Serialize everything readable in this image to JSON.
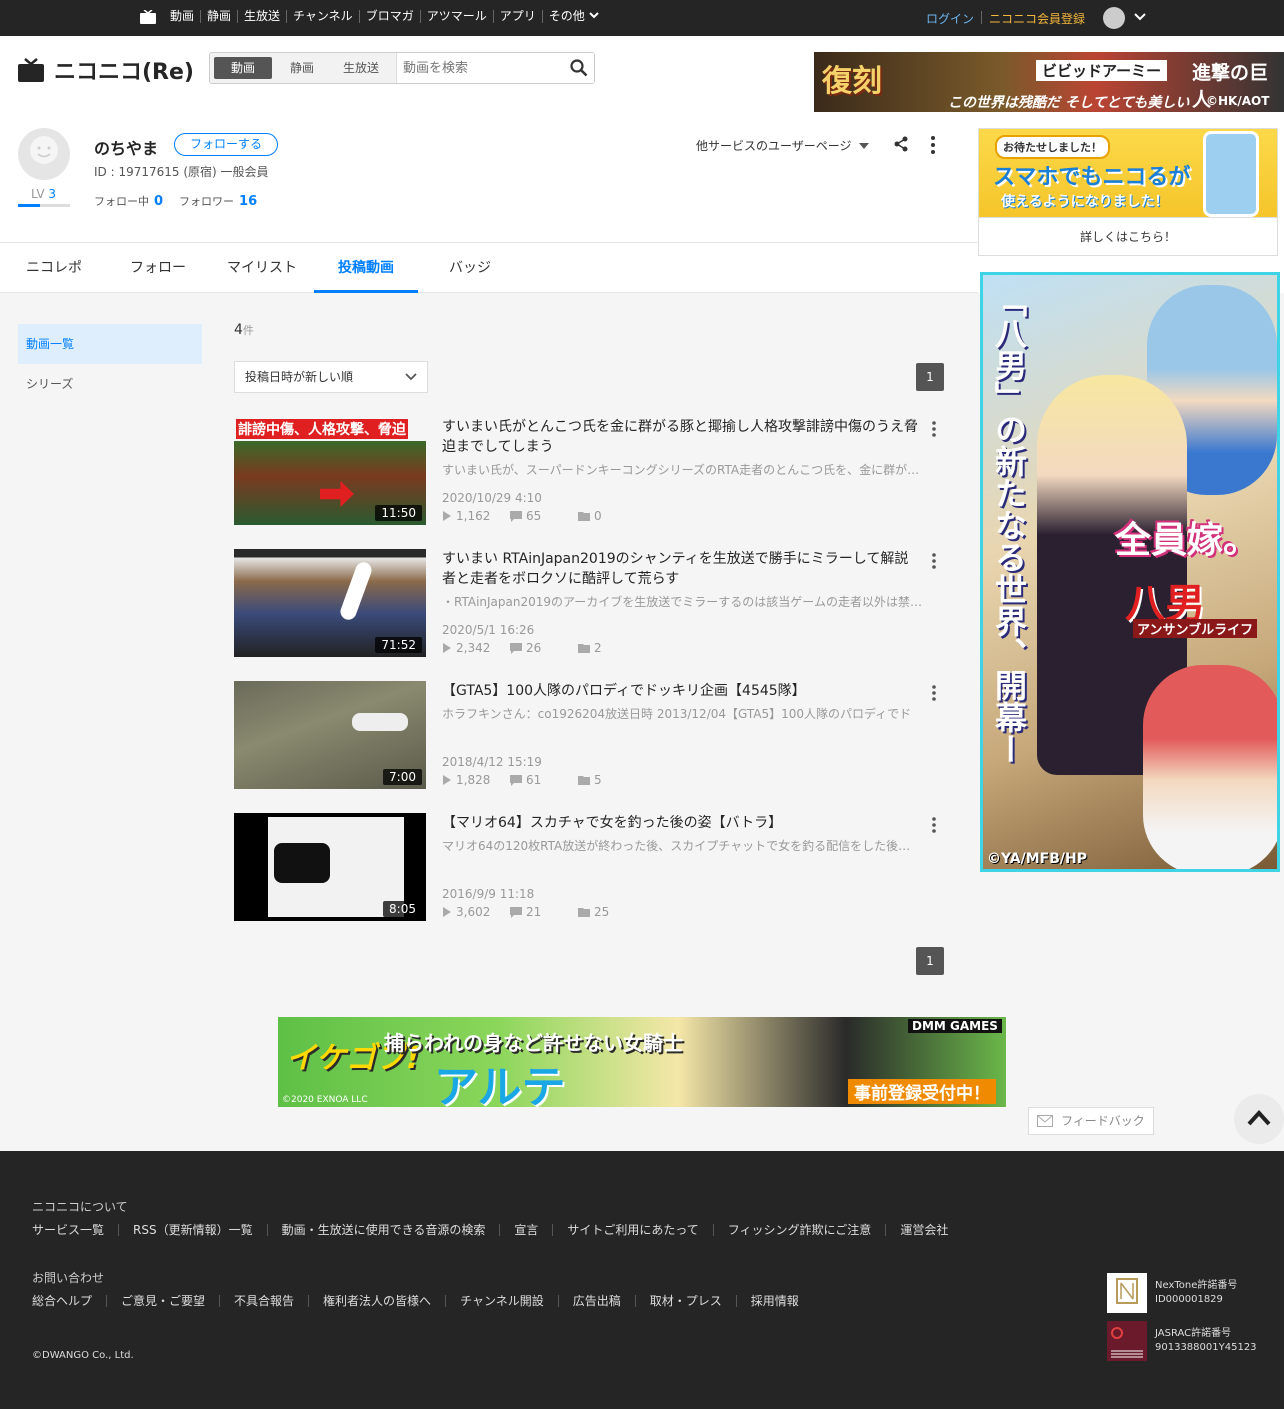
{
  "topnav": {
    "links": [
      "動画",
      "静画",
      "生放送",
      "チャンネル",
      "ブロマガ",
      "アツマール",
      "アプリ",
      "その他"
    ],
    "login": "ログイン",
    "register": "ニコニコ会員登録"
  },
  "header": {
    "logo": "ニコニコ(Re)",
    "search_tabs": [
      "動画",
      "静画",
      "生放送"
    ],
    "search_placeholder": "動画を検索",
    "banner": {
      "t1": "復刻",
      "t2": "ビビッドアーミー",
      "t3": "進撃の巨人",
      "t4": "この世界は残酷だ そしてとても美しい",
      "t5": "©HK/AOT"
    }
  },
  "user": {
    "name": "のちやま",
    "follow_button": "フォローする",
    "id_line": "ID : 19717615 (原宿) 一般会員",
    "level_label": "LV",
    "level": "3",
    "level_progress": 0.42,
    "following_label": "フォロー中",
    "following": "0",
    "followers_label": "フォロワー",
    "followers": "16",
    "other_services": "他サービスのユーザーページ"
  },
  "tabs": [
    "ニコレポ",
    "フォロー",
    "マイリスト",
    "投稿動画",
    "バッジ"
  ],
  "sidebar": [
    "動画一覧",
    "シリーズ"
  ],
  "list": {
    "count": "4",
    "count_unit": "件",
    "sort": "投稿日時が新しい順",
    "page": "1",
    "items": [
      {
        "title": "すいまい氏がとんこつ氏を金に群がる豚と揶揄し人格攻撃誹謗中傷のうえ脅迫までしてしまう",
        "desc": "すいまい氏が、スーパードンキーコングシリーズのRTA走者のとんこつ氏を、金に群がる豚と揶揄し人格攻撃誹謗中傷",
        "date": "2020/10/29 4:10",
        "views": "1,162",
        "comments": "65",
        "mylists": "0",
        "duration": "11:50"
      },
      {
        "title": "すいまい RTAinJapan2019のシャンティを生放送で勝手にミラーして解説者と走者をボロクソに酷評して荒らす",
        "desc": "・RTAinJapan2019のアーカイブを生放送でミラーするのは該当ゲームの走者以外は禁止されています",
        "date": "2020/5/1 16:26",
        "views": "2,342",
        "comments": "26",
        "mylists": "2",
        "duration": "71:52"
      },
      {
        "title": "【GTA5】100人隊のパロディでドッキリ企画【4545隊】",
        "desc": "ホラフキンさん：co1926204放送日時 2013/12/04【GTA5】100人隊のパロディでド",
        "date": "2018/4/12 15:19",
        "views": "1,828",
        "comments": "61",
        "mylists": "5",
        "duration": "7:00"
      },
      {
        "title": "【マリオ64】スカチャで女を釣った後の姿【バトラ】",
        "desc": "マリオ64の120枚RTA放送が終わった後、スカイプチャットで女を釣る配信をした後の姿",
        "date": "2016/9/9 11:18",
        "views": "3,602",
        "comments": "21",
        "mylists": "25",
        "duration": "8:05"
      }
    ]
  },
  "ads": {
    "right_top": {
      "t1": "お待たせしました！",
      "t2": "スマホでもニコるが",
      "t3": "使えるようになりました！",
      "link": "詳しくはこちら！"
    },
    "right_tall": {
      "vert": "「八男」の新たなる世界、開幕ー",
      "t1": "全員嫁。",
      "t2": "八男",
      "t3": "アンサンブルライフ",
      "copy": "©YA/MFB/HP"
    },
    "bottom": {
      "t1": "イケゴブ!",
      "t2": "捕らわれの身など許せない女騎士",
      "t3": "アルテ",
      "t4": "DMM GAMES",
      "t5": "事前登録受付中！",
      "t6": "©2020 EXNOA LLC"
    }
  },
  "feedback": "フィードバック",
  "footer": {
    "about": "ニコニコについて",
    "row1": [
      "サービス一覧",
      "RSS（更新情報）一覧",
      "動画・生放送に使用できる音源の検索",
      "宣言",
      "サイトご利用にあたって",
      "フィッシング詐欺にご注意",
      "運営会社"
    ],
    "contact": "お問い合わせ",
    "row2": [
      "総合ヘルプ",
      "ご意見・ご要望",
      "不具合報告",
      "権利者法人の皆様へ",
      "チャンネル開設",
      "広告出稿",
      "取材・プレス",
      "採用情報"
    ],
    "copyright": "©DWANGO Co., Ltd.",
    "nextone": {
      "label": "NexTone許諾番号",
      "id": "ID000001829"
    },
    "jasrac": {
      "label": "JASRAC許諾番号",
      "id": "9013388001Y45123"
    }
  },
  "colors": {
    "accent": "#0080ff",
    "dark": "#252525",
    "login": "#6cb6f0",
    "register": "#f5b73b"
  }
}
